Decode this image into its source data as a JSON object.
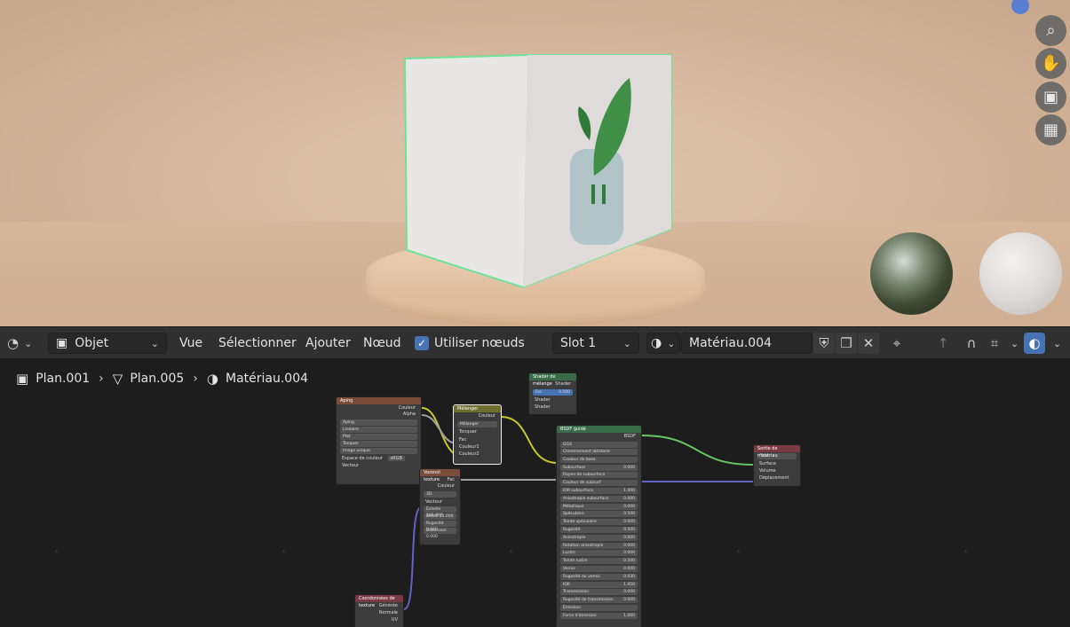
{
  "header": {
    "editor_type_icon": "shader-editor-icon",
    "mode": "Objet",
    "menus": [
      "Vue",
      "Sélectionner",
      "Ajouter",
      "Nœud"
    ],
    "use_nodes_label": "Utiliser nœuds",
    "use_nodes_checked": true,
    "slot": "Slot 1",
    "material_name": "Matériau.004"
  },
  "breadcrumb": {
    "object": "Plan.001",
    "mesh": "Plan.005",
    "material": "Matériau.004"
  },
  "nodes": {
    "image": {
      "title": "Aping",
      "out_color": "Couleur",
      "out_alpha": "Alpha",
      "image_name": "Aping",
      "interp": "Linéaire",
      "proj": "Plat",
      "ext": "Tonquer",
      "source": "Image unique",
      "colorspace_label": "Espace de couleur",
      "colorspace": "sRGB",
      "vector": "Vecteur"
    },
    "mix": {
      "title": "Mélanger",
      "out": "Couleur",
      "mode": "Mélanger",
      "clamp": "Tonquer",
      "fac": "Fac",
      "c1": "Couleur1",
      "c2": "Couleur2"
    },
    "mixshader": {
      "title": "Shader de mélange",
      "out": "Shader",
      "fac_label": "Fac",
      "fac_value": "0.500",
      "in1": "Shader",
      "in2": "Shader"
    },
    "voronoi": {
      "title": "Voronoï texture",
      "out_fac": "Fac",
      "out_color": "Couleur",
      "dim": "3D",
      "vector": "Vecteur",
      "scale": "Échelle 100.000",
      "detail": "Détail 15.000",
      "rough": "Rugosité 0.500",
      "distortion": "Distorsion 0.000"
    },
    "bsdf": {
      "title": "BSDF guidé",
      "out": "BSDF",
      "dist": "GGX",
      "sss_method": "Cheminement aléatoire",
      "rows": [
        {
          "label": "Couleur de base",
          "value": ""
        },
        {
          "label": "Subsurface",
          "value": "0.000"
        },
        {
          "label": "Rayon de subsurface",
          "value": ""
        },
        {
          "label": "Couleur de subsurf.",
          "value": ""
        },
        {
          "label": "IOR subsurface",
          "value": "1.400"
        },
        {
          "label": "Anisotropie subsurface",
          "value": "0.000"
        },
        {
          "label": "Métallique",
          "value": "0.000"
        },
        {
          "label": "Spéculaire",
          "value": "0.500"
        },
        {
          "label": "Teinte spéculaire",
          "value": "0.000"
        },
        {
          "label": "Rugosité",
          "value": "0.500"
        },
        {
          "label": "Anisotropie",
          "value": "0.000"
        },
        {
          "label": "Rotation anisotropie",
          "value": "0.000"
        },
        {
          "label": "Lustre",
          "value": "0.000"
        },
        {
          "label": "Teinte lustre",
          "value": "0.500"
        },
        {
          "label": "Vernis",
          "value": "0.000"
        },
        {
          "label": "Rugosité du vernis",
          "value": "0.030"
        },
        {
          "label": "IOR",
          "value": "1.450"
        },
        {
          "label": "Transmission",
          "value": "0.000"
        },
        {
          "label": "Rugosité de transmission",
          "value": "0.000"
        },
        {
          "label": "Émission",
          "value": ""
        },
        {
          "label": "Force d'émission",
          "value": "1.000"
        }
      ]
    },
    "output": {
      "title": "Sortie de matériau",
      "target": "Tout",
      "surface": "Surface",
      "volume": "Volume",
      "displacement": "Déplacement"
    },
    "texcoord": {
      "title": "Coordonnées de texture",
      "generated": "Générée",
      "normal": "Normale",
      "uv": "UV"
    }
  },
  "colors": {
    "accent": "#4772b3",
    "header_bg": "#303030",
    "editor_bg": "#1d1d1d",
    "selection": "#63e38a"
  }
}
